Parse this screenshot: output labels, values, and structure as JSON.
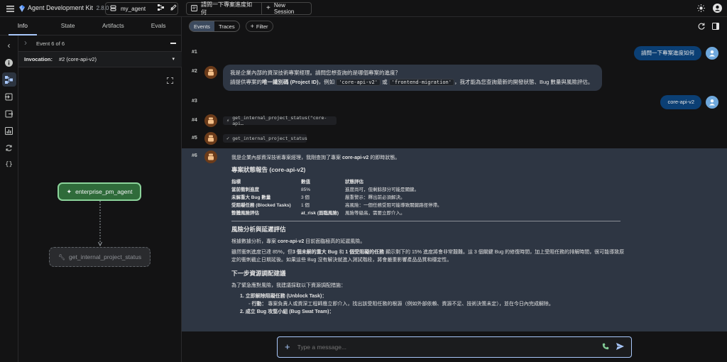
{
  "app": {
    "title": "Agent Development Kit",
    "version": "2.8.0"
  },
  "topbar": {
    "agent_name": "my_agent",
    "session_title": "請問一下專案進度如何",
    "new_session_label": "New Session"
  },
  "left_tabs": [
    "Info",
    "State",
    "Artifacts",
    "Evals"
  ],
  "event_nav": {
    "label": "Event 6 of 6"
  },
  "invocation": {
    "label": "Invocation:",
    "value": "#2 (core-api-v2)"
  },
  "graph": {
    "agent_node": "enterprise_pm_agent",
    "tool_node": "get_internal_project_status"
  },
  "filter": {
    "events_label": "Events",
    "traces_label": "Traces",
    "filter_label": "Filter"
  },
  "events": {
    "e1": {
      "num": "#1",
      "text": "請問一下專案進度如何"
    },
    "e2": {
      "num": "#2",
      "line1": "我是企業內部的資深技術專案經理。請問您想查詢的是哪個專案的進度？",
      "line2_a": "請提供專案的",
      "line2_b": "唯一識別碼 (Project ID)",
      "line2_c": "，例如",
      "code1": "'core-api-v2'",
      "line2_d": "或",
      "code2": "'frontend-migration'",
      "line2_e": "，我才能為您查詢最新的開發狀態、Bug 數量與風險評估。"
    },
    "e3": {
      "num": "#3",
      "text": "core-api-v2"
    },
    "e4": {
      "num": "#4",
      "text": "get_internal_project_status(\"core-api…"
    },
    "e5": {
      "num": "#5",
      "text": "get_internal_project_status"
    },
    "e6": {
      "num": "#6",
      "intro_a": "我是企業內部資深技術專案經理，我剛查詢了專案",
      "intro_b": "core-api-v2",
      "intro_c": "的即時狀態。",
      "report_title": "專案狀態報告 (core-api-v2)",
      "table": {
        "headers": [
          "指標",
          "數值",
          "狀態評估"
        ],
        "rows": [
          [
            "當前衝刺進度",
            "85%",
            "進度尚可，但剩餘部分可能是關鍵。"
          ],
          [
            "未解重大 Bug 數量",
            "3 個",
            "嚴重警示：釋出前必須解決。"
          ],
          [
            "受阻礙任務 (Blocked Tasks)",
            "1 個",
            "高風險：一個任務受阻可能導致關鍵路徑停滯。"
          ],
          [
            "整體風險評估",
            "at_risk (面臨風險)",
            "風險等級高，需要立即介入。"
          ]
        ]
      },
      "risk_title": "風險分析與延遲評估",
      "risk_p1_a": "根據數據分析，專案",
      "risk_p1_b": "core-api-v2",
      "risk_p1_c": "目前面臨極高的延遲風險。",
      "risk_p2_a": "雖然衝刺進度已達 85%，但",
      "risk_p2_b": "3 個未解的重大 Bug",
      "risk_p2_c": "和",
      "risk_p2_d": "1 個受阻礙的任務",
      "risk_p2_e": "顯示剩下的 15% 進度將會非常艱難。這 3 個關鍵 Bug 的修復時間，加上受阻任務的排解時間，很可能導致原定的衝刺截止日期延後。如果這些 Bug 沒有解決就進入測試階段，將會嚴重影響產品品質和穩定性。",
      "next_title": "下一步資源調配建議",
      "next_intro": "為了緊急應對風險，我建議採取以下資源調配措施：",
      "step1_title": "1. 立即解除阻礙任務 (Unblock Task)：",
      "step1_action_label": "行動：",
      "step1_action": "專案負責人或資深工程師應立即介入，找出該受阻任務的根源（例如外部依賴、資源不足、技術決策未定），並在今日內完成解除。",
      "step2_title": "2. 成立 Bug 攻堅小組 (Bug Swat Team)："
    }
  },
  "composer": {
    "placeholder": "Type a message..."
  }
}
